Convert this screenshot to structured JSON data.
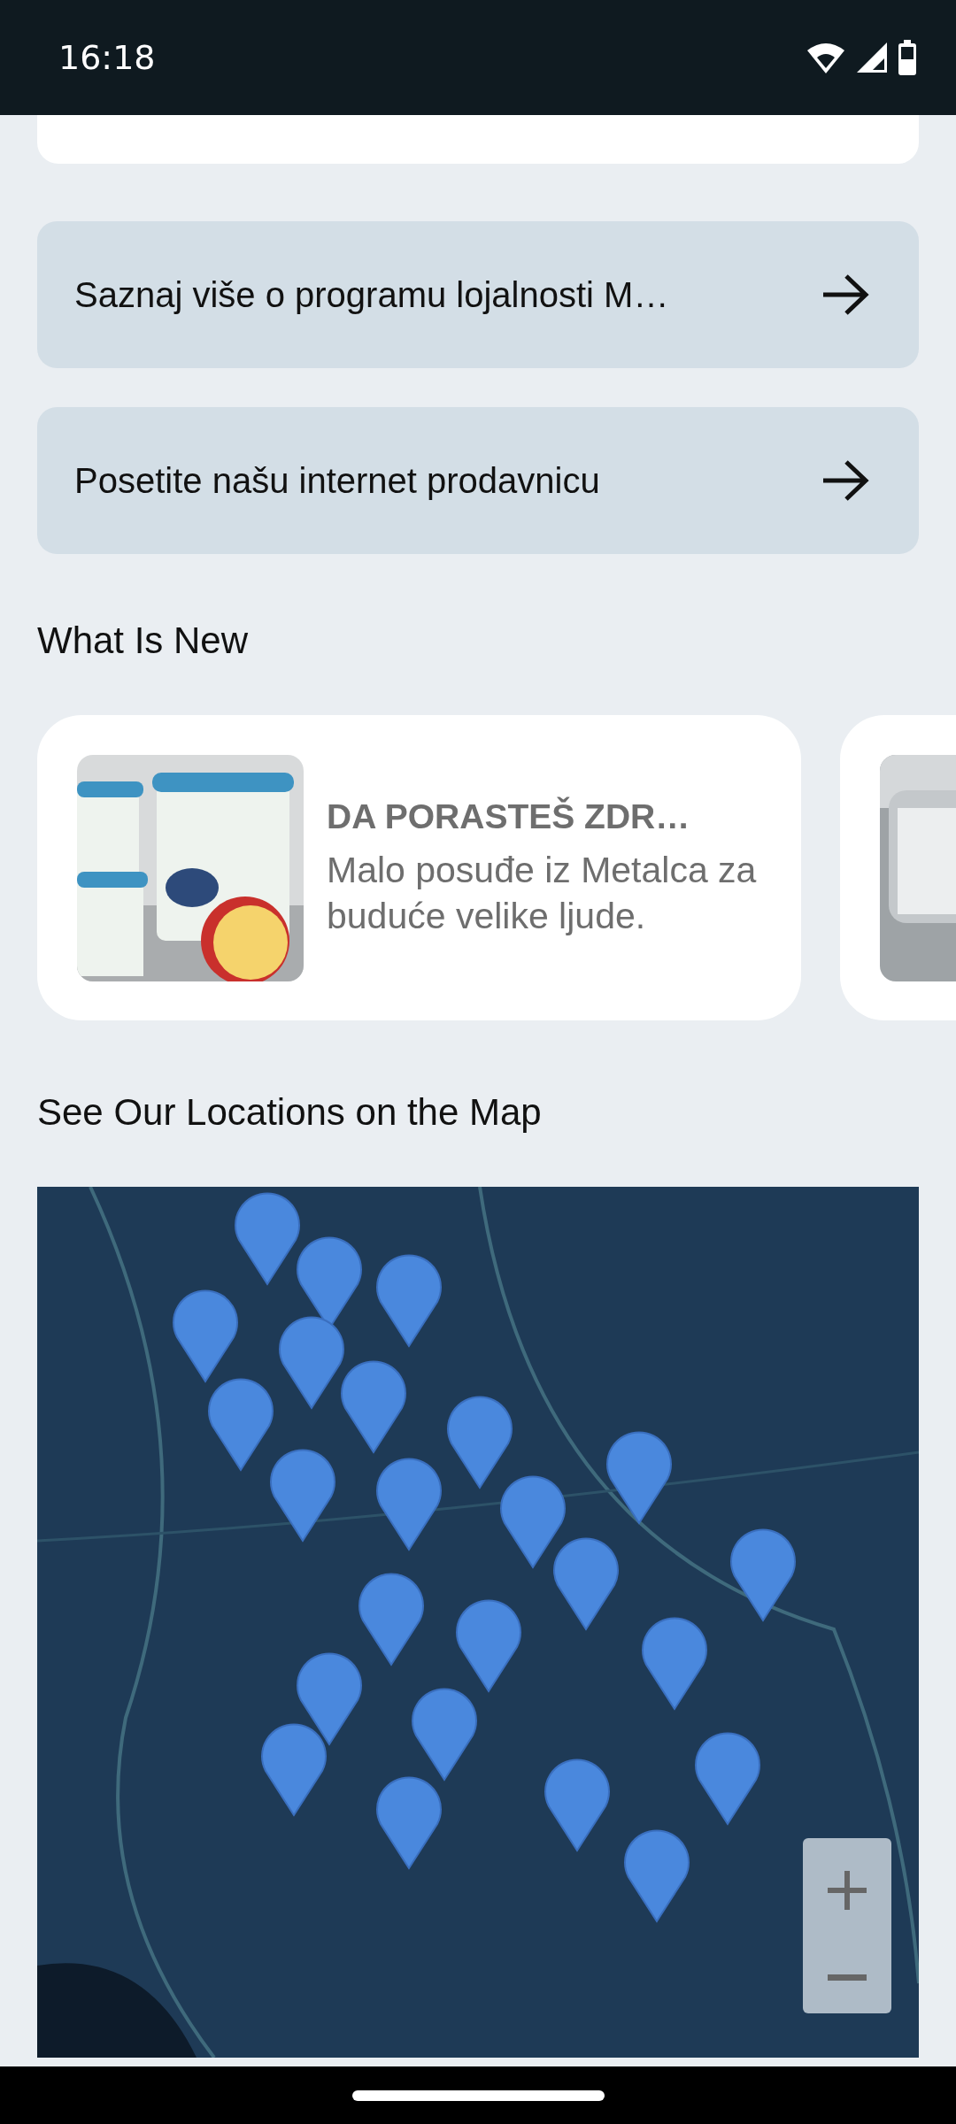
{
  "status_bar": {
    "time": "16:18"
  },
  "links": [
    {
      "label": "Saznaj više o programu lojalnosti M…"
    },
    {
      "label": "Posetite našu internet prodavnicu"
    }
  ],
  "news": {
    "heading": "What Is New",
    "items": [
      {
        "title": "DA PORASTEŠ ZDR…",
        "text": "Malo posuđe iz Metalca za buduće velike ljude."
      }
    ]
  },
  "map": {
    "heading": "See Our Locations on the Map"
  }
}
